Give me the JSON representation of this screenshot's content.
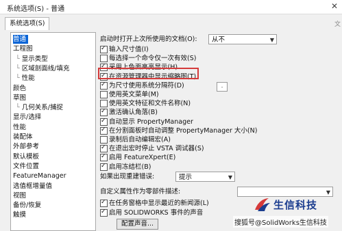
{
  "window": {
    "title": "系统选项(S) - 普通",
    "close_glyph": "✕"
  },
  "tab": {
    "label": "系统选项(S)",
    "ghost_label": "文"
  },
  "tree": {
    "items": [
      {
        "label": "普通",
        "selected": true,
        "indent": 0
      },
      {
        "label": "工程图",
        "indent": 0
      },
      {
        "label": "显示类型",
        "indent": 1
      },
      {
        "label": "区域剖面线/填充",
        "indent": 1
      },
      {
        "label": "性能",
        "indent": 1
      },
      {
        "label": "颜色",
        "indent": 0
      },
      {
        "label": "草图",
        "indent": 0
      },
      {
        "label": "几何关系/捕捉",
        "indent": 1
      },
      {
        "label": "显示/选择",
        "indent": 0
      },
      {
        "label": "性能",
        "indent": 0
      },
      {
        "label": "装配体",
        "indent": 0
      },
      {
        "label": "外部参考",
        "indent": 0
      },
      {
        "label": "默认模板",
        "indent": 0
      },
      {
        "label": "文件位置",
        "indent": 0
      },
      {
        "label": "FeatureManager",
        "indent": 0
      },
      {
        "label": "选值框增量值",
        "indent": 0
      },
      {
        "label": "视图",
        "indent": 0
      },
      {
        "label": "备份/恢复",
        "indent": 0
      },
      {
        "label": "触摸",
        "indent": 0
      }
    ]
  },
  "panel": {
    "startup_label": "启动时打开上次所使用的文档(O):",
    "startup_value": "从不",
    "options": [
      {
        "label": "输入尺寸值(I)",
        "checked": true
      },
      {
        "label": "每选择一个命令仅一次有效(S)",
        "checked": false
      },
      {
        "label": "采用上色面高亮显示(H)",
        "checked": true
      },
      {
        "label": "在资源管理器中显示缩略图(T)",
        "checked": true
      },
      {
        "label": "为尺寸使用系统分隔符(D)",
        "checked": true
      },
      {
        "label": "使用英文菜单(M)",
        "checked": false
      },
      {
        "label": "使用英文特征和文件名称(N)",
        "checked": false
      },
      {
        "label": "激活确认角落(B)",
        "checked": true
      },
      {
        "label": "自动显示 PropertyManager",
        "checked": true
      },
      {
        "label": "在分割面板时自动调整 PropertyManager 大小(N)",
        "checked": true
      },
      {
        "label": "录制后自动编辑宏(A)",
        "checked": false
      },
      {
        "label": "在退出宏时停止 VSTA 调试器(S)",
        "checked": true
      },
      {
        "label": "启用 FeatureXpert(E)",
        "checked": true
      },
      {
        "label": "启用冻结栏(B)",
        "checked": true
      }
    ],
    "separator_value": ".",
    "rebuild_label": "如果出现重建错误:",
    "rebuild_value": "提示",
    "custom_prop_label": "自定义属性作为零部件描述:",
    "custom_prop_value": "",
    "bottom_options": [
      {
        "label": "在任务窗格中显示最近的新闻源(L)",
        "checked": true
      },
      {
        "label": "启用 SOLIDWORKS 事件的声音",
        "checked": true
      }
    ],
    "sound_button": "配置声音..."
  },
  "logo": {
    "brand": "生信科技"
  },
  "watermark": "搜狐号@SolidWorks生信科技",
  "colors": {
    "selection": "#0a64d6",
    "highlight_frame": "#d53a3a",
    "brand": "#1b3d8f"
  }
}
